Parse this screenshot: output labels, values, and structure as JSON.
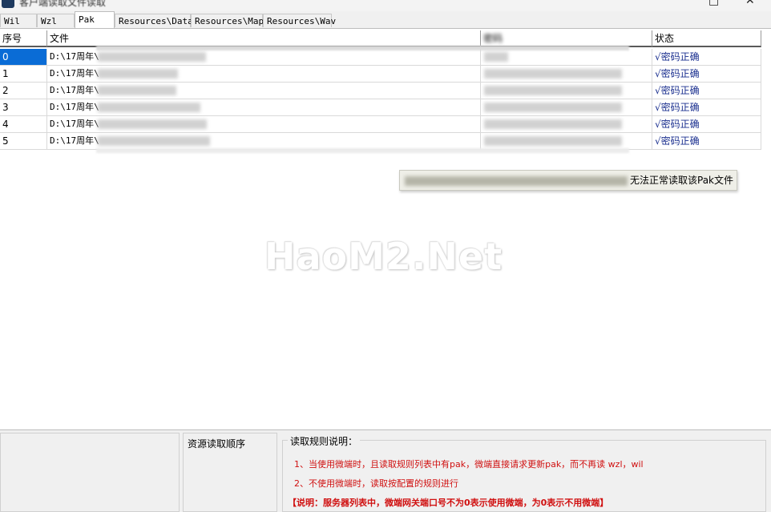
{
  "window": {
    "title": "客户端读取文件读取"
  },
  "tabs": [
    {
      "label": "Wil",
      "active": false
    },
    {
      "label": "Wzl",
      "active": false
    },
    {
      "label": "Pak",
      "active": true
    },
    {
      "label": "Resources\\Data",
      "active": false
    },
    {
      "label": "Resources\\Map",
      "active": false
    },
    {
      "label": "Resources\\Wav",
      "active": false
    }
  ],
  "grid": {
    "columns": [
      "序号",
      "文件",
      "密码",
      "状态"
    ],
    "rows": [
      {
        "index": "0",
        "file": "D:\\17周年\\",
        "status": "√密码正确"
      },
      {
        "index": "1",
        "file": "D:\\17周年\\",
        "status": "√密码正确"
      },
      {
        "index": "2",
        "file": "D:\\17周年\\",
        "status": "√密码正确"
      },
      {
        "index": "3",
        "file": "D:\\17周年\\",
        "status": "√密码正确"
      },
      {
        "index": "4",
        "file": "D:\\17周年\\",
        "status": "√密码正确"
      },
      {
        "index": "5",
        "file": "D:\\17周年\\",
        "status": "√密码正确"
      }
    ]
  },
  "tooltip": {
    "text": "无法正常读取该Pak文件"
  },
  "watermark": "HaoM2.Net",
  "bottom": {
    "order_label": "资源读取顺序",
    "rules_label": "读取规则说明：",
    "rules": [
      "1、当使用微端时，且读取规则列表中有pak，微端直接请求更新pak，而不再读 wzl，wil",
      "2、不使用微端时，读取按配置的规则进行",
      "【说明：服务器列表中，微端网关端口号不为0表示使用微端，为0表示不用微端】"
    ]
  },
  "colors": {
    "selection": "#0a6cd6",
    "status_text": "#1a2f8f",
    "rules_text": "#d01010"
  }
}
